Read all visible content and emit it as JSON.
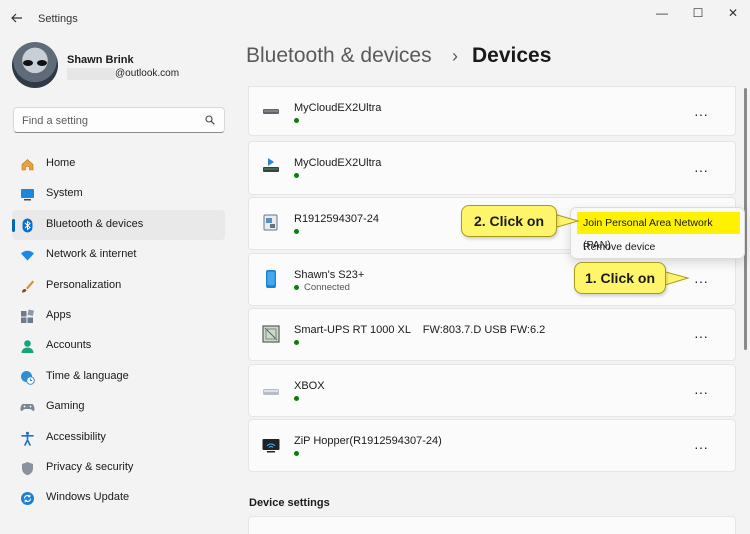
{
  "window": {
    "title": "Settings",
    "minimize": "—",
    "maximize": "☐",
    "close": "✕"
  },
  "profile": {
    "name": "Shawn Brink",
    "email": "@outlook.com"
  },
  "search": {
    "placeholder": "Find a setting"
  },
  "nav": {
    "items": [
      {
        "label": "Home",
        "icon": "home-icon",
        "active": false
      },
      {
        "label": "System",
        "icon": "system-icon",
        "active": false
      },
      {
        "label": "Bluetooth & devices",
        "icon": "bluetooth-icon",
        "active": true
      },
      {
        "label": "Network & internet",
        "icon": "wifi-icon",
        "active": false
      },
      {
        "label": "Personalization",
        "icon": "brush-icon",
        "active": false
      },
      {
        "label": "Apps",
        "icon": "apps-icon",
        "active": false
      },
      {
        "label": "Accounts",
        "icon": "accounts-icon",
        "active": false
      },
      {
        "label": "Time & language",
        "icon": "globe-clock-icon",
        "active": false
      },
      {
        "label": "Gaming",
        "icon": "gamepad-icon",
        "active": false
      },
      {
        "label": "Accessibility",
        "icon": "accessibility-icon",
        "active": false
      },
      {
        "label": "Privacy & security",
        "icon": "shield-icon",
        "active": false
      },
      {
        "label": "Windows Update",
        "icon": "update-icon",
        "active": false
      }
    ]
  },
  "breadcrumb": {
    "parent": "Bluetooth & devices",
    "separator": "›",
    "current": "Devices"
  },
  "devices": [
    {
      "name": "MyCloudEX2Ultra",
      "status": "",
      "icon": "nas-drive-icon"
    },
    {
      "name": "MyCloudEX2Ultra",
      "status": "",
      "icon": "media-server-icon"
    },
    {
      "name": "R1912594307-24",
      "status": "",
      "icon": "unknown-device-icon"
    },
    {
      "name": "Shawn's S23+",
      "status": "Connected",
      "icon": "phone-icon"
    },
    {
      "name": "Smart-UPS RT 1000 XL    FW:803.7.D USB FW:6.2",
      "status": "",
      "icon": "ups-icon"
    },
    {
      "name": "XBOX",
      "status": "",
      "icon": "console-icon"
    },
    {
      "name": "ZiP Hopper(R1912594307-24)",
      "status": "",
      "icon": "monitor-icon"
    }
  ],
  "more_glyph": "···",
  "context_menu": {
    "items": [
      "Join Personal Area Network (PAN)",
      "Remove device"
    ]
  },
  "callouts": {
    "step1": "1. Click on",
    "step2": "2. Click on"
  },
  "section": {
    "device_settings": "Device settings"
  },
  "colors": {
    "accent": "#0067c0",
    "status_dot": "#0f7b0f",
    "callout": "#fff56a",
    "highlight": "#fff200"
  }
}
